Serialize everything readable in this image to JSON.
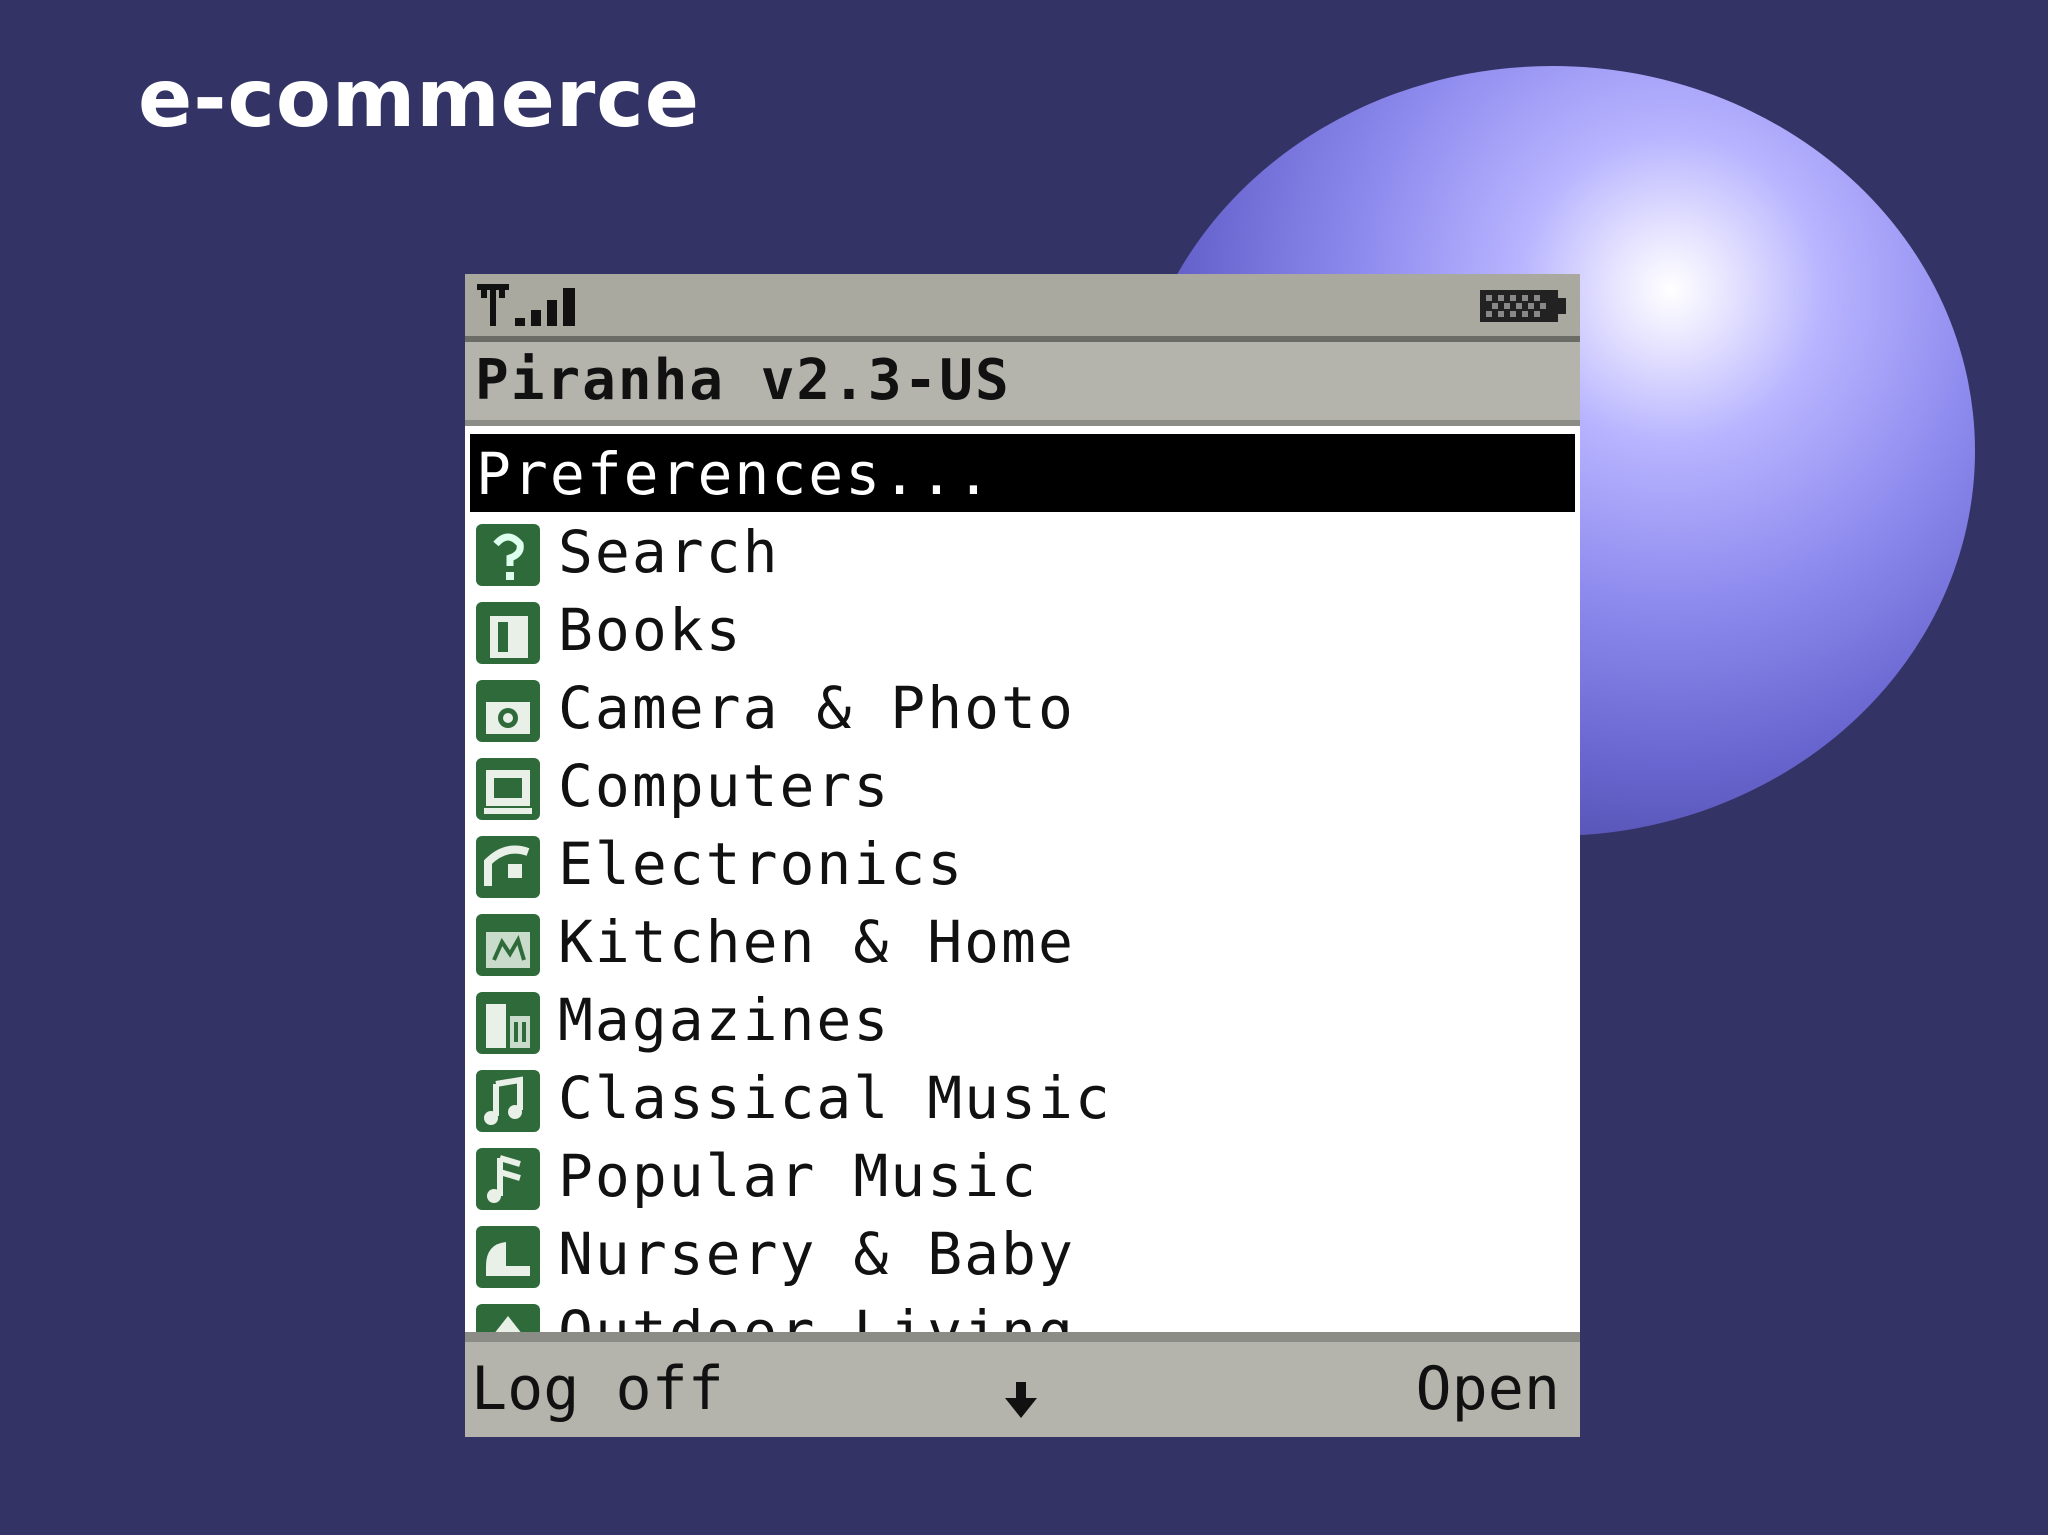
{
  "slide": {
    "title": "e-commerce"
  },
  "phone": {
    "app_title": "Piranha v2.3-US",
    "status_icons": [
      "antenna-icon",
      "signal-strength-icon",
      "battery-icon"
    ],
    "menu": {
      "selected_index": 0,
      "items": [
        {
          "label": "Preferences...",
          "icon": null
        },
        {
          "label": "Search",
          "icon": "search-question-icon"
        },
        {
          "label": "Books",
          "icon": "book-icon"
        },
        {
          "label": "Camera & Photo",
          "icon": "camera-icon"
        },
        {
          "label": "Computers",
          "icon": "computer-icon"
        },
        {
          "label": "Electronics",
          "icon": "electronics-icon"
        },
        {
          "label": "Kitchen & Home",
          "icon": "kitchen-icon"
        },
        {
          "label": "Magazines",
          "icon": "magazine-icon"
        },
        {
          "label": "Classical Music",
          "icon": "classical-music-icon"
        },
        {
          "label": "Popular Music",
          "icon": "popular-music-icon"
        },
        {
          "label": "Nursery & Baby",
          "icon": "nursery-icon"
        },
        {
          "label": "Outdoor Living",
          "icon": "outdoor-icon"
        }
      ]
    },
    "softkeys": {
      "left": "Log off",
      "center_icon": "scroll-down-arrow-icon",
      "right": "Open"
    },
    "colors": {
      "highlight_bg": "#000000",
      "icon_green": "#2f6b3a",
      "bar_gray": "#b4b4ac"
    }
  }
}
